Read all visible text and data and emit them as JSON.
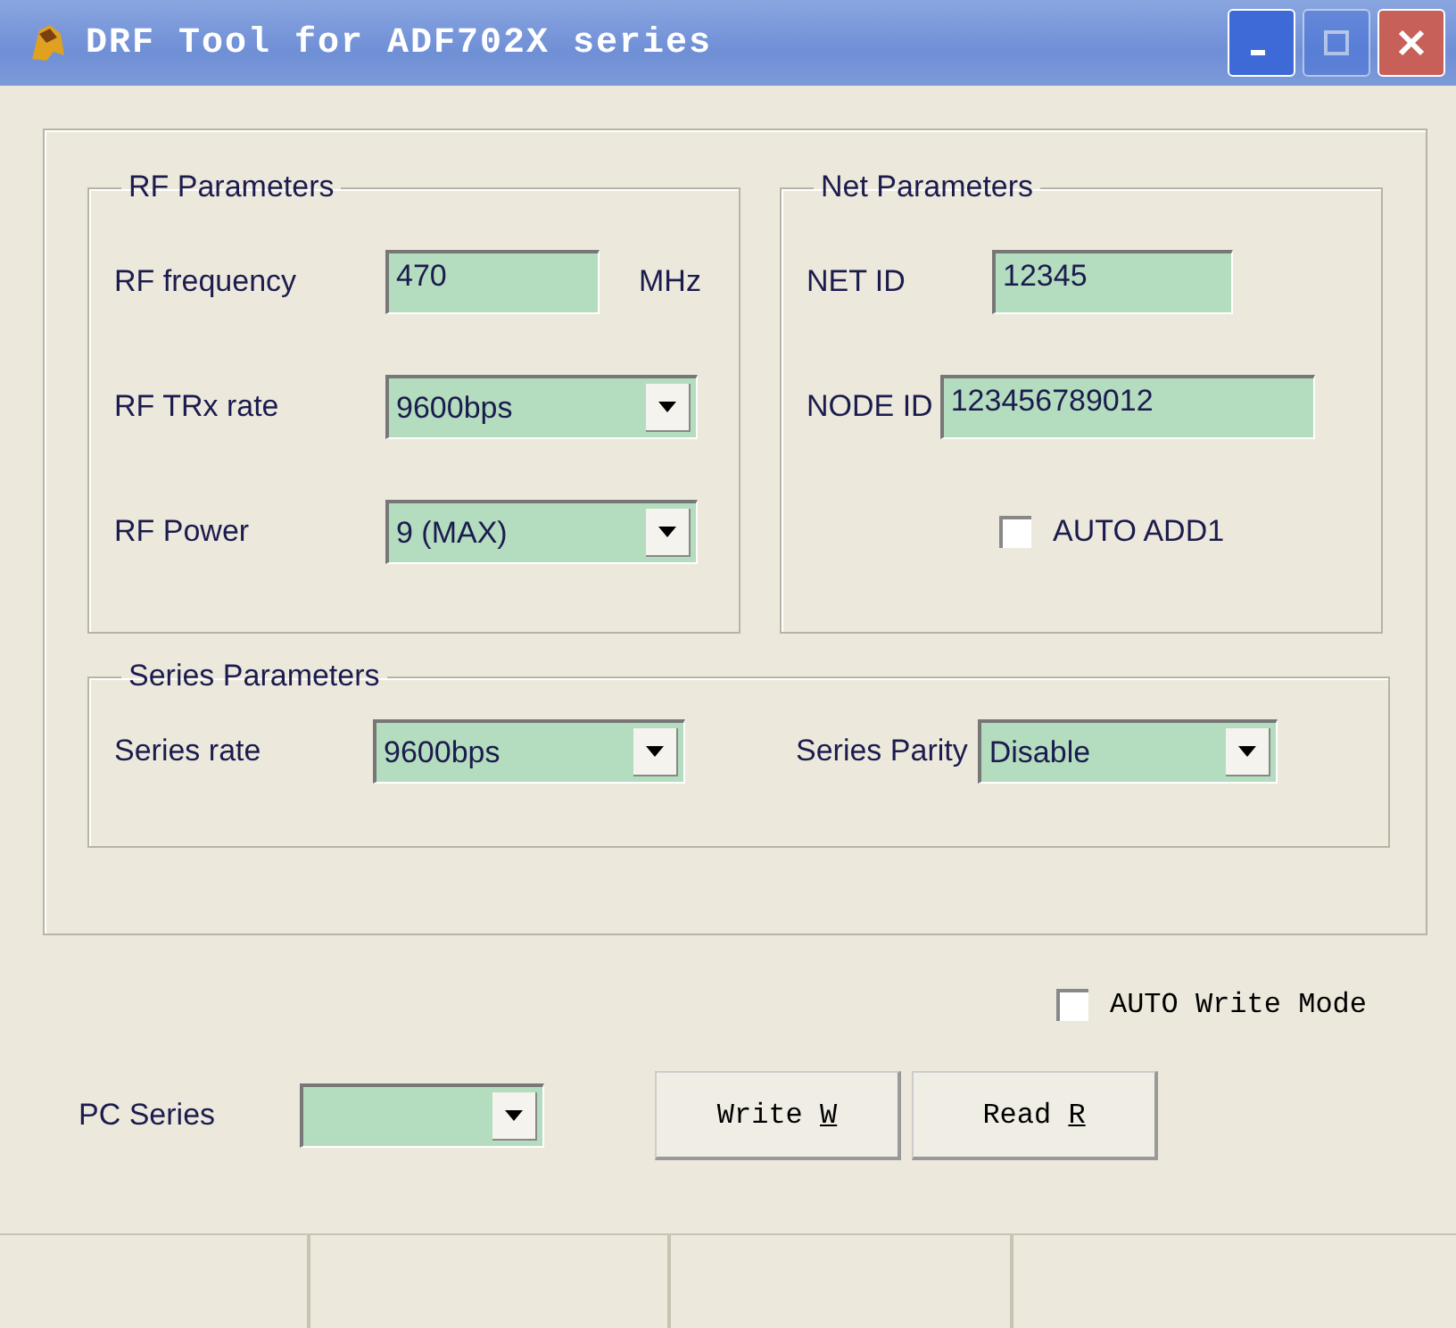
{
  "window": {
    "title": "DRF Tool for ADF702X series"
  },
  "title_buttons": [
    {
      "kind": "minimize",
      "disabled": false
    },
    {
      "kind": "maximize",
      "disabled": true
    },
    {
      "kind": "close",
      "disabled": false
    }
  ],
  "rf_parameters": {
    "title": "RF Parameters",
    "fields": [
      {
        "kind": "text",
        "label": "RF frequency",
        "value": "470",
        "unit": "MHz"
      },
      {
        "kind": "dropdown",
        "label": "RF TRx rate",
        "value": "9600bps"
      },
      {
        "kind": "dropdown",
        "label": "RF Power",
        "value": "9 (MAX)"
      }
    ]
  },
  "net_parameters": {
    "title": "Net Parameters",
    "fields": [
      {
        "kind": "text",
        "label": "NET ID",
        "value": "12345"
      },
      {
        "kind": "text",
        "label": "NODE ID",
        "value": "123456789012"
      }
    ],
    "checkbox": {
      "label": "AUTO ADD1",
      "checked": false
    }
  },
  "series_parameters": {
    "title": "Series Parameters",
    "fields": [
      {
        "kind": "dropdown",
        "label": "Series rate",
        "value": "9600bps"
      },
      {
        "kind": "dropdown",
        "label": "Series Parity",
        "value": "Disable"
      }
    ]
  },
  "auto_write": {
    "label": "AUTO Write Mode",
    "checked": false
  },
  "pc_series": {
    "label": "PC Series"
  },
  "buttons": [
    {
      "label": "Write",
      "accelerator": "W"
    },
    {
      "label": "Read",
      "accelerator": "R"
    }
  ]
}
